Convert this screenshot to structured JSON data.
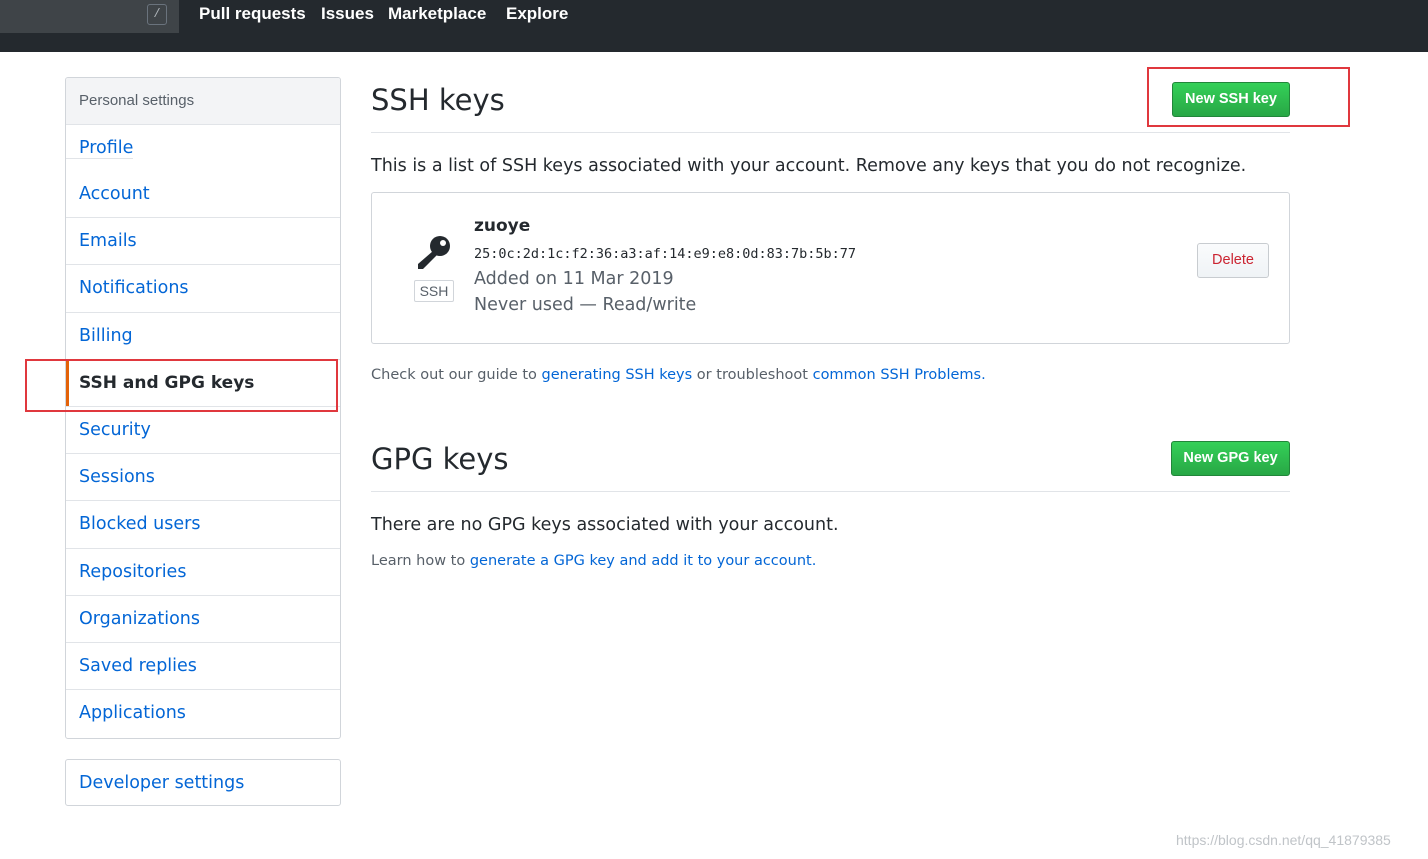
{
  "header": {
    "search_shortcut": "/",
    "nav": [
      "Pull requests",
      "Issues",
      "Marketplace",
      "Explore"
    ]
  },
  "sidebar": {
    "heading": "Personal settings",
    "items": [
      {
        "label": "Profile"
      },
      {
        "label": "Account"
      },
      {
        "label": "Emails"
      },
      {
        "label": "Notifications"
      },
      {
        "label": "Billing"
      },
      {
        "label": "SSH and GPG keys",
        "selected": true
      },
      {
        "label": "Security"
      },
      {
        "label": "Sessions"
      },
      {
        "label": "Blocked users"
      },
      {
        "label": "Repositories"
      },
      {
        "label": "Organizations"
      },
      {
        "label": "Saved replies"
      },
      {
        "label": "Applications"
      }
    ],
    "developer_settings": "Developer settings"
  },
  "ssh": {
    "title": "SSH keys",
    "new_button": "New SSH key",
    "intro": "This is a list of SSH keys associated with your account. Remove any keys that you do not recognize.",
    "key": {
      "name": "zuoye",
      "fingerprint": "25:0c:2d:1c:f2:36:a3:af:14:e9:e8:0d:83:7b:5b:77",
      "added": "Added on 11 Mar 2019",
      "usage": "Never used — Read/write",
      "badge": "SSH",
      "delete_label": "Delete"
    },
    "guide_prefix": "Check out our guide to ",
    "guide_link": "generating SSH keys",
    "guide_middle": " or troubleshoot ",
    "guide_link2": "common SSH Problems",
    "guide_suffix": "."
  },
  "gpg": {
    "title": "GPG keys",
    "new_button": "New GPG key",
    "empty_text": "There are no GPG keys associated with your account.",
    "learn_prefix": "Learn how to ",
    "learn_link": "generate a GPG key and add it to your account",
    "learn_suffix": "."
  },
  "colors": {
    "header_bg": "#24292e",
    "link": "#0366d6",
    "green_button": "#28a745",
    "highlight": "#e0383e",
    "selected_bar": "#e36209"
  },
  "watermark": "https://blog.csdn.net/qq_41879385"
}
